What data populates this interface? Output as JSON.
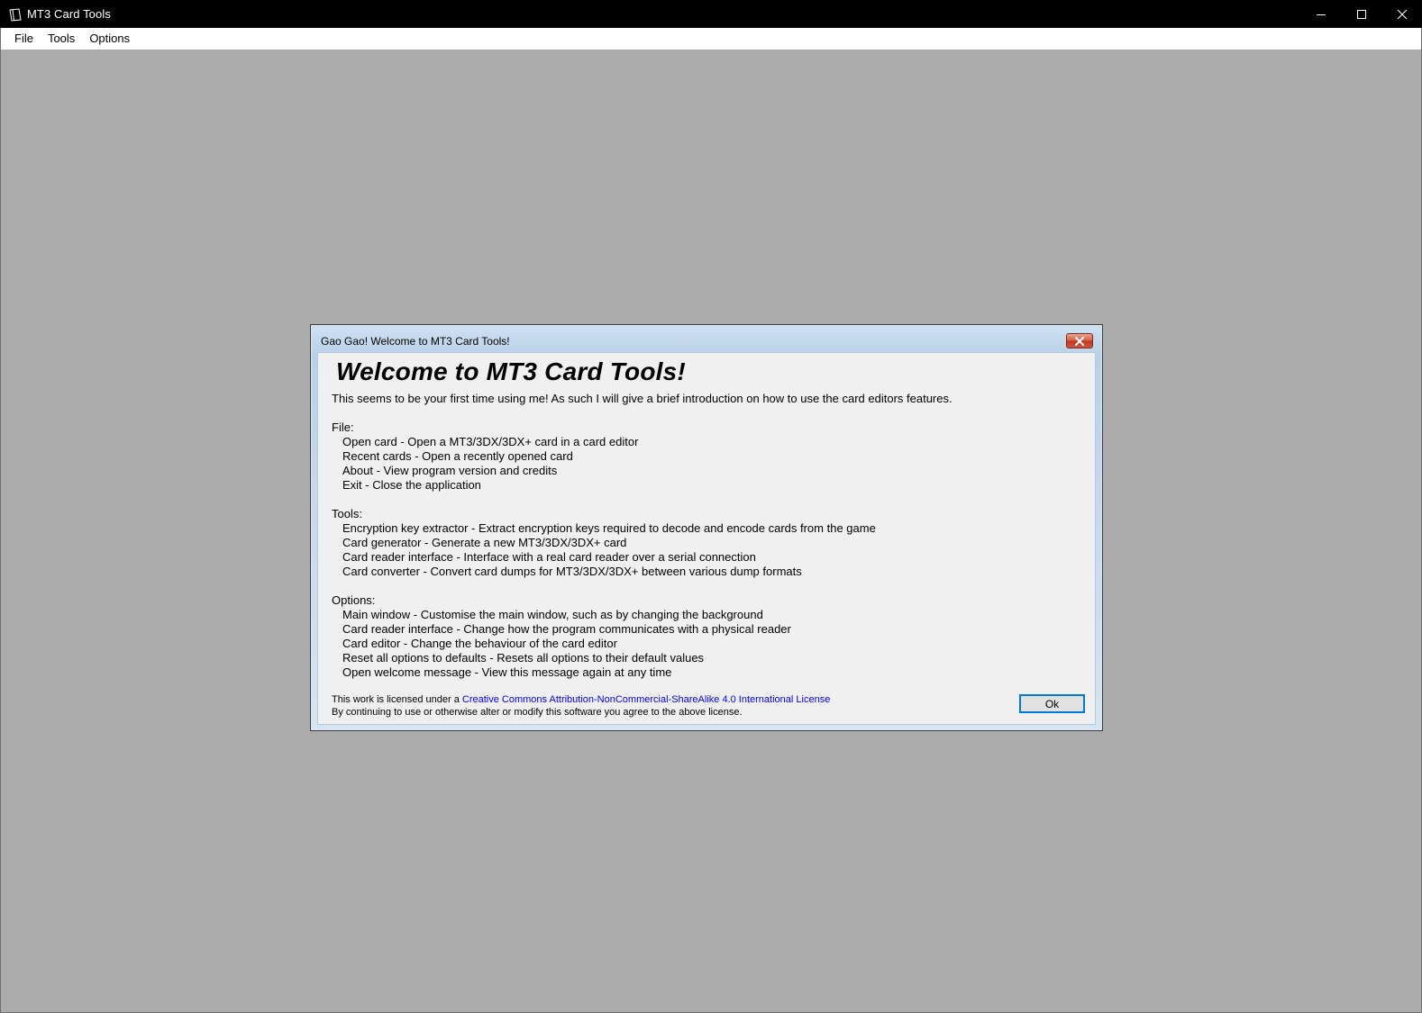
{
  "window": {
    "title": "MT3 Card Tools",
    "icon": "card-icon"
  },
  "menu": {
    "items": [
      {
        "label": "File"
      },
      {
        "label": "Tools"
      },
      {
        "label": "Options"
      }
    ]
  },
  "dialog": {
    "title": "Gao Gao! Welcome to MT3 Card Tools!",
    "heading": "Welcome to MT3 Card Tools!",
    "intro": "This seems to be your first time using me! As such I will give a brief introduction on how to use the card editors features.",
    "sections": [
      {
        "title": "File:",
        "lines": [
          "Open card - Open a MT3/3DX/3DX+ card in a card editor",
          "Recent cards - Open a recently opened card",
          "About - View program version and credits",
          "Exit - Close the application"
        ]
      },
      {
        "title": "Tools:",
        "lines": [
          "Encryption key extractor - Extract encryption keys required to decode and encode cards from the game",
          "Card generator - Generate a new MT3/3DX/3DX+ card",
          "Card reader interface - Interface with a real card reader over a serial connection",
          "Card converter - Convert card dumps for MT3/3DX/3DX+ between various dump formats"
        ]
      },
      {
        "title": "Options:",
        "lines": [
          "Main window - Customise the main window, such as by changing the background",
          "Card reader interface - Change how the program communicates with a physical reader",
          "Card editor - Change the behaviour of the card editor",
          "Reset all options to defaults - Resets all options to their default values",
          "Open welcome message - View this message again at any time"
        ]
      }
    ],
    "license_prefix": "This work is licensed under a ",
    "license_link": "Creative Commons Attribution-NonCommercial-ShareAlike 4.0 International License",
    "license_note": "By continuing to use or otherwise alter or modify this software you agree to the above license.",
    "ok_label": "Ok"
  },
  "colors": {
    "titlebar": "#000000",
    "desktop": "#ababab",
    "link": "#0000ff",
    "focus": "#0078d7"
  }
}
